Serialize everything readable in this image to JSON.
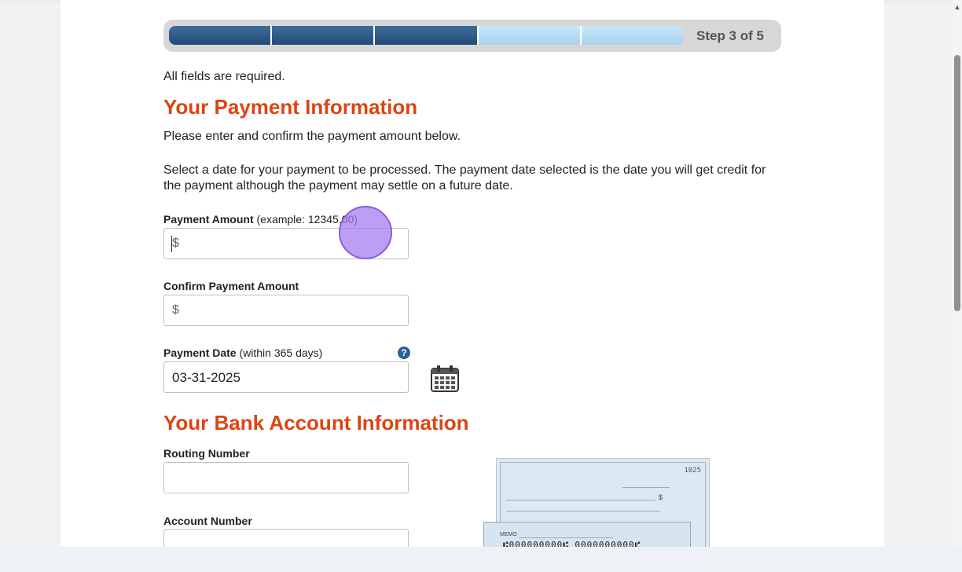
{
  "progress": {
    "step_label": "Step 3 of 5",
    "completed_steps": 3,
    "total_steps": 5
  },
  "intro": {
    "required_note": "All fields are required."
  },
  "payment_section": {
    "heading": "Your Payment Information",
    "instructions_1": "Please enter and confirm the payment amount below.",
    "instructions_2": "Select a date for your payment to be processed. The payment date selected is the date you will get credit for the payment although the payment may settle on a future date.",
    "amount": {
      "label": "Payment Amount",
      "hint": "(example: 12345.00)",
      "currency_prefix": "$",
      "value": ""
    },
    "confirm_amount": {
      "label": "Confirm Payment Amount",
      "currency_prefix": "$",
      "value": ""
    },
    "date": {
      "label": "Payment Date",
      "hint": "(within 365 days)",
      "value": "03-31-2025",
      "help_icon": "question-circle-icon",
      "calendar_icon": "calendar-icon"
    }
  },
  "bank_section": {
    "heading": "Your Bank Account Information",
    "routing": {
      "label": "Routing Number",
      "value": ""
    },
    "account": {
      "label": "Account Number",
      "value": ""
    },
    "check_image": {
      "check_number": "1025",
      "dollar_sign": "$",
      "memo_label": "MEMO",
      "micr_line": "⑆000000000⑆ 0000000000⑈"
    }
  },
  "colors": {
    "heading": "#dd4411",
    "progress_done": "#2f5d8c",
    "progress_todo": "#b8def5",
    "help_icon": "#2d5f99"
  }
}
